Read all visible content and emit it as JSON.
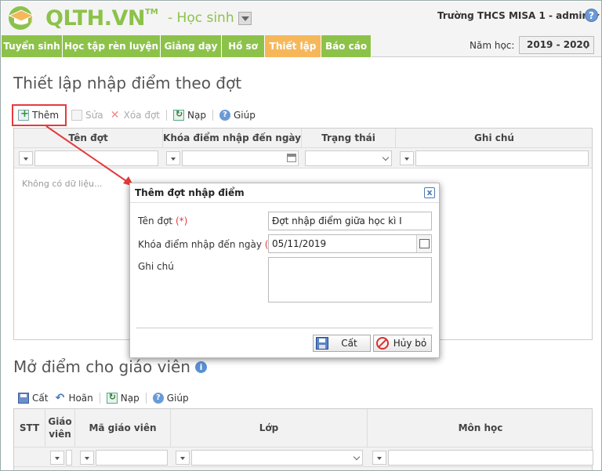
{
  "header": {
    "logo_text": "QLTH.VN",
    "logo_tm": "TM",
    "module_label": "- Học sinh",
    "school_user": "Trường THCS MISA 1 - admin",
    "help_glyph": "?"
  },
  "nav": {
    "items": [
      "Tuyển sinh",
      "Học tập rèn luyện",
      "Giảng dạy",
      "Hồ sơ",
      "Thiết lập",
      "Báo cáo"
    ],
    "active": "Thiết lập",
    "active_color": "#f6b75b",
    "item_color": "#8dc24a",
    "year_label": "Năm học:",
    "year_value": "2019 - 2020"
  },
  "section1": {
    "title": "Thiết lập nhập điểm theo đợt",
    "toolbar": {
      "add": "Thêm",
      "edit": "Sửa",
      "delete": "Xóa đợt",
      "reload": "Nạp",
      "help": "Giúp"
    },
    "columns": [
      "Tên đợt",
      "Khóa điểm nhập đến ngày",
      "Trạng thái",
      "Ghi chú"
    ],
    "empty_text": "Không có dữ liệu..."
  },
  "dialog": {
    "title": "Thêm đợt nhập điểm",
    "close_glyph": "x",
    "name_label": "Tên đợt",
    "lock_label": "Khóa điểm nhập đến ngày",
    "required_mark": "(*)",
    "note_label": "Ghi chú",
    "name_value": "Đợt nhập điểm giữa học kì I",
    "lock_value": "05/11/2019",
    "note_value": "",
    "save_label": "Cất",
    "cancel_label": "Hủy bỏ"
  },
  "section2": {
    "title": "Mở điểm cho giáo viên",
    "info_glyph": "i",
    "toolbar": {
      "save": "Cất",
      "undo": "Hoãn",
      "reload": "Nạp",
      "help": "Giúp"
    },
    "columns": [
      "STT",
      "Giáo viên",
      "Mã giáo viên",
      "Lớp",
      "Môn học"
    ]
  },
  "accent_red": "#e53b3b"
}
